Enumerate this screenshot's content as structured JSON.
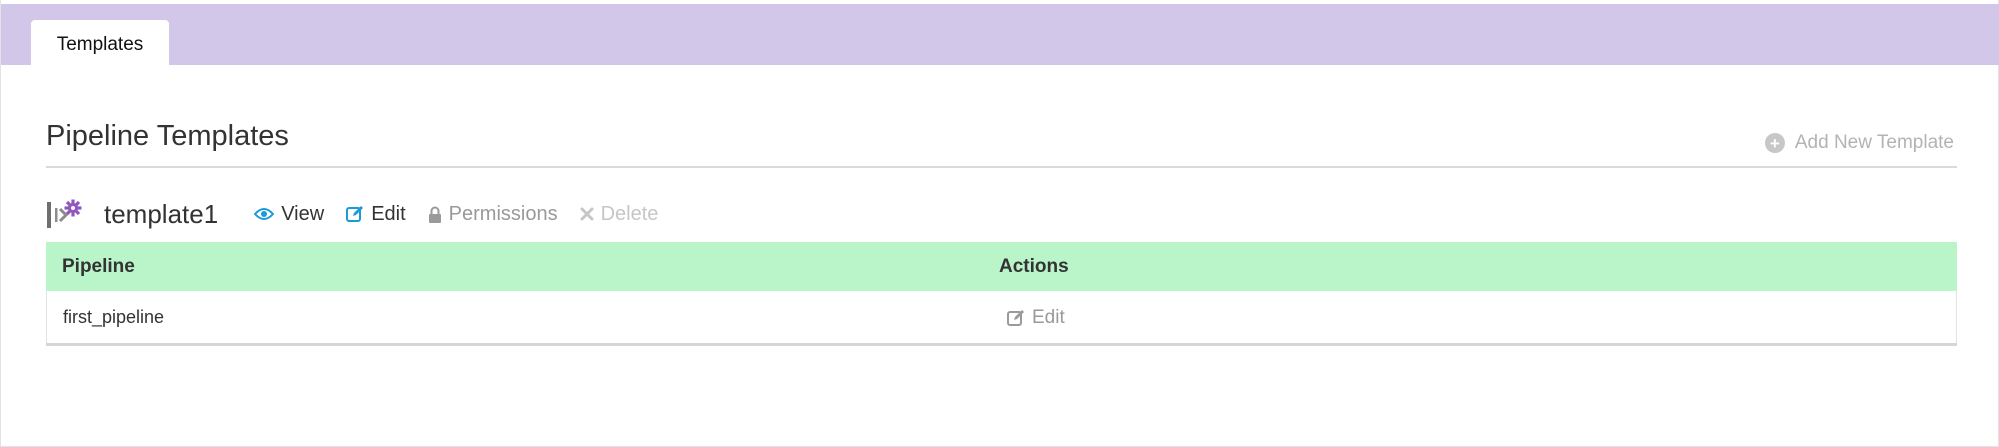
{
  "tabs": [
    {
      "label": "Templates",
      "active": true
    }
  ],
  "page": {
    "title": "Pipeline Templates",
    "add_new_label": "Add New Template"
  },
  "template": {
    "name": "template1",
    "actions": {
      "view": "View",
      "edit": "Edit",
      "permissions": "Permissions",
      "delete": "Delete"
    }
  },
  "table": {
    "columns": [
      "Pipeline",
      "Actions"
    ],
    "rows": [
      {
        "pipeline": "first_pipeline",
        "action_label": "Edit"
      }
    ]
  },
  "colors": {
    "tab_bar": "#d2c6e9",
    "table_header": "#b9f5c9",
    "accent_blue": "#1a9ad6",
    "template_icon_purple": "#8e57c2"
  }
}
